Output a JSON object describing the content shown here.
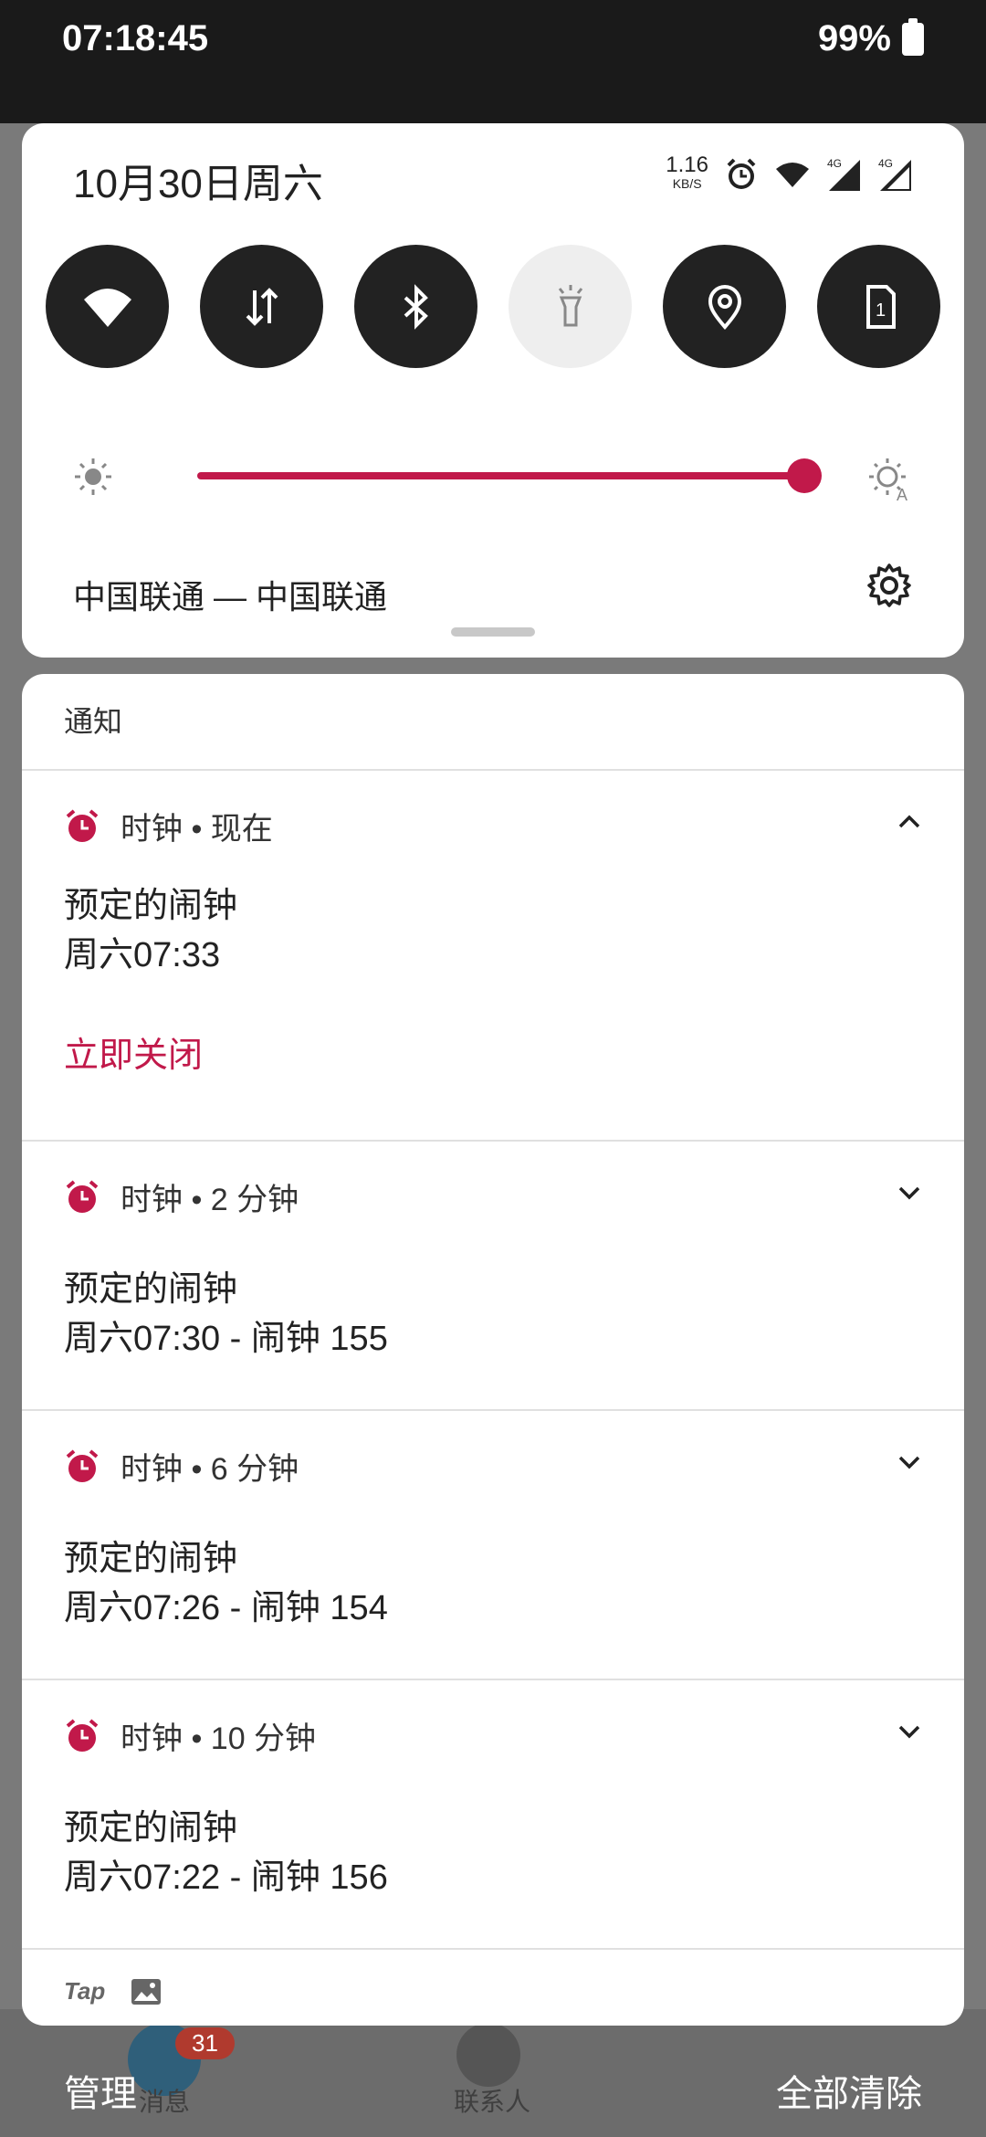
{
  "status_bar": {
    "time": "07:18:45",
    "battery": "99%"
  },
  "quick_settings": {
    "date": "10月30日周六",
    "net_speed": "1.16",
    "net_unit": "KB/S",
    "tiles": [
      "wifi-icon",
      "data-icon",
      "bluetooth-icon",
      "flashlight-icon",
      "location-icon",
      "sim-icon"
    ],
    "brightness_percent": 96,
    "carrier": "中国联通 — 中国联通",
    "accent_color": "#c1194a"
  },
  "notifications": {
    "header": "通知",
    "items": [
      {
        "app": "时钟 • 现在",
        "title": "预定的闹钟",
        "subtitle": "周六07:33",
        "action": "立即关闭",
        "expanded": true
      },
      {
        "app": "时钟 • 2 分钟",
        "title": "预定的闹钟",
        "subtitle": "周六07:30 - 闹钟 155",
        "expanded": false
      },
      {
        "app": "时钟 • 6 分钟",
        "title": "预定的闹钟",
        "subtitle": "周六07:26 - 闹钟 154",
        "expanded": false
      },
      {
        "app": "时钟 • 10 分钟",
        "title": "预定的闹钟",
        "subtitle": "周六07:22 - 闹钟 156",
        "expanded": false
      }
    ],
    "footer_app": "Tap"
  },
  "bottom_actions": {
    "manage": "管理",
    "clear_all": "全部清除"
  },
  "background_app": {
    "badge": "31",
    "tab_messages": "消息",
    "tab_contacts": "联系人"
  }
}
